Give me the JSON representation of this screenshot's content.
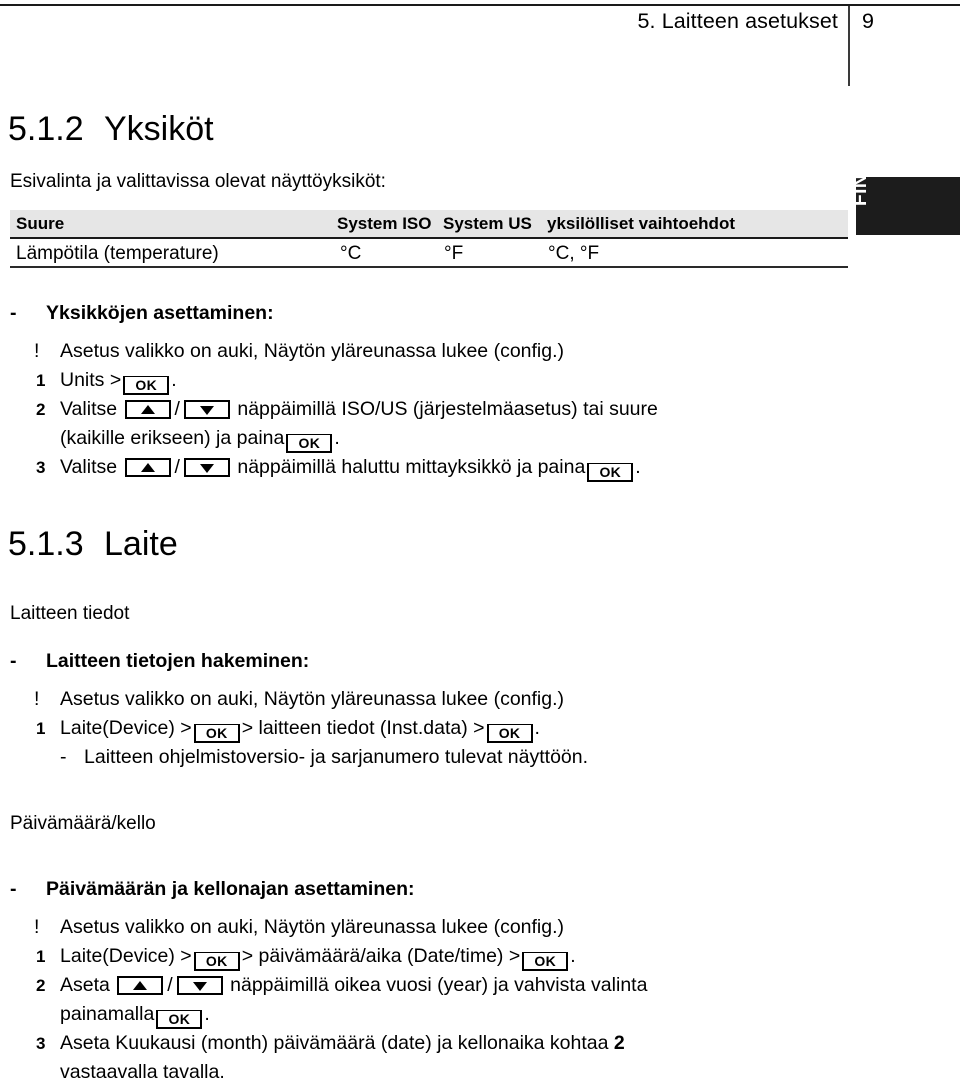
{
  "header": {
    "title": "5. Laitteen asetukset",
    "page_number": "9"
  },
  "language_tab": {
    "label": "FIN"
  },
  "section_units": {
    "number": "5.1.2",
    "title": "Yksiköt",
    "intro": "Esivalinta ja valittavissa olevat näyttöyksiköt:",
    "table": {
      "headers": [
        "Suure",
        "System ISO",
        "System US",
        "yksilölliset vaihtoehdot"
      ],
      "rows": [
        [
          "Lämpötila (temperature)",
          "°C",
          "°F",
          "°C, °F"
        ]
      ]
    },
    "list_heading": "Yksikköjen asettaminen:",
    "note_marker": "!",
    "note": "Asetus valikko on auki, Näytön yläreunassa lukee (config.)",
    "steps": [
      {
        "marker": "1",
        "part1": "Units >",
        "key1": "OK",
        "part2": "."
      },
      {
        "marker": "2",
        "part1": "Valitse",
        "key_up": "up-arrow",
        "slash": "/",
        "key_down": "down-arrow",
        "part2": "näppäimillä ISO/US (järjestelmäasetus) tai suure",
        "line2_part1": "(kaikille erikseen) ja paina",
        "key2": "OK",
        "line2_part2": "."
      },
      {
        "marker": "3",
        "part1": "Valitse",
        "slash": "/",
        "part2": "näppäimillä haluttu mittayksikkö ja paina",
        "key2": "OK",
        "part3": "."
      }
    ]
  },
  "section_device": {
    "number": "5.1.3",
    "title": "Laite",
    "subtitle": "Laitteen tiedot",
    "list_heading": "Laitteen tietojen hakeminen:",
    "note_marker": "!",
    "note": "Asetus valikko on auki, Näytön yläreunassa lukee (config.)",
    "step1": {
      "marker": "1",
      "part1": "Laite(Device) >",
      "key1": "OK",
      "part2": "> laitteen tiedot (Inst.data) >",
      "key2": "OK",
      "part3": "."
    },
    "substep": {
      "marker": "-",
      "text": "Laitteen ohjelmistoversio- ja sarjanumero tulevat näyttöön."
    }
  },
  "section_datetime": {
    "subtitle": "Päivämäärä/kello",
    "list_heading": "Päivämäärän ja kellonajan asettaminen:",
    "note_marker": "!",
    "note": "Asetus valikko on auki, Näytön yläreunassa lukee (config.)",
    "steps": [
      {
        "marker": "1",
        "part1": "Laite(Device) >",
        "key1": "OK",
        "part2": "> päivämäärä/aika (Date/time) >",
        "key2": "OK",
        "part3": "."
      },
      {
        "marker": "2",
        "part1": "Aseta",
        "slash": "/",
        "part2": "näppäimillä oikea vuosi (year) ja vahvista valinta",
        "line2_part1": "painamalla",
        "key2": "OK",
        "line2_part2": "."
      },
      {
        "marker": "3",
        "part1": "Aseta Kuukausi (month) päivämäärä (date) ja kellonaika kohtaa",
        "bold_ref": "2",
        "line2": "vastaavalla tavalla."
      }
    ]
  }
}
